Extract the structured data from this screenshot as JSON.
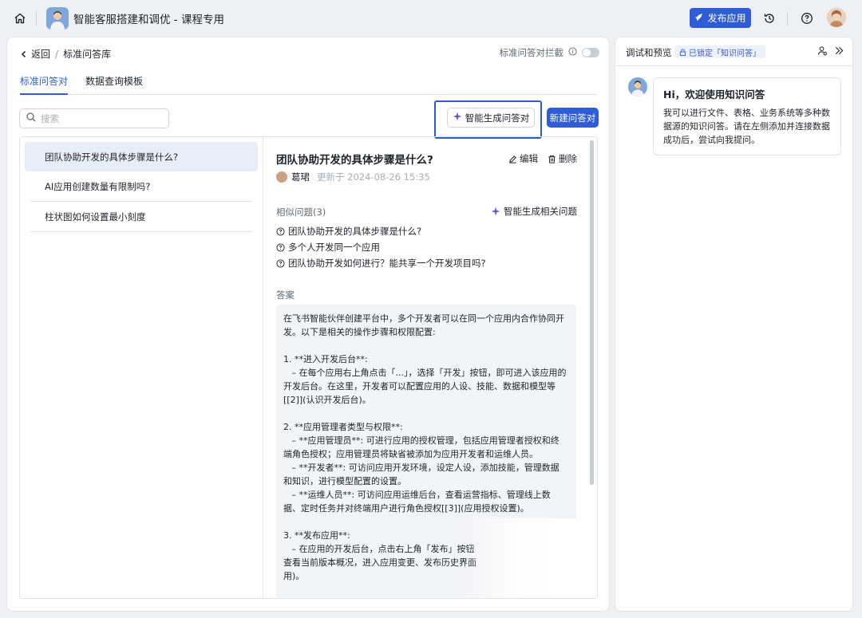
{
  "topbar": {
    "app_title": "智能客服搭建和调优 - 课程专用",
    "publish_label": "发布应用",
    "icons": [
      "home-icon",
      "rocket-icon",
      "history-icon",
      "help-icon"
    ]
  },
  "left": {
    "breadcrumb": {
      "back": "返回",
      "current": "标准问答库"
    },
    "intercept_label": "标准问答对拦截",
    "tabs": [
      {
        "label": "标准问答对",
        "active": true
      },
      {
        "label": "数据查询模板",
        "active": false
      }
    ],
    "search_placeholder": "搜索",
    "smart_gen_label": "智能生成问答对",
    "new_label": "新建问答对",
    "questions": [
      "团队协助开发的具体步骤是什么?",
      "AI应用创建数量有限制吗?",
      "柱状图如何设置最小刻度"
    ],
    "detail": {
      "title": "团队协助开发的具体步骤是什么?",
      "edit_label": "编辑",
      "delete_label": "删除",
      "author": "葛珺",
      "updated": "更新于 2024-08-26 15:35",
      "similar_label": "相似问题(3)",
      "similar_gen_label": "智能生成相关问题",
      "similar": [
        "团队协助开发的具体步骤是什么?",
        "多个人开发同一个应用",
        "团队协助开发如何进行？能共享一个开发项目吗?"
      ],
      "answer_label": "答案",
      "answer": "在飞书智能伙伴创建平台中，多个开发者可以在同一个应用内合作协同开\n发。以下是相关的操作步骤和权限配置:\n\n1. **进入开发后台**:\n   – 在每个应用右上角点击「...」，选择「开发」按钮，即可进入该应用的\n开发后台。在这里，开发者可以配置应用的人设、技能、数据和模型等\n[[2]](认识开发后台)。\n\n2. **应用管理者类型与权限**:\n   – **应用管理员**: 可进行应用的授权管理，包括应用管理者授权和终\n端角色授权；应用管理员将缺省被添加为应用开发者和运维人员。\n   – **开发者**: 可访问应用开发环境，设定人设，添加技能，管理数据\n和知识，进行模型配置的设置。\n   – **运维人员**: 可访问应用运维后台，查看运营指标、管理线上数\n据、定时任务并对终端用户进行角色授权[[3]](应用授权设置)。\n\n3. **发布应用**:\n   – 在应用的开发后台，点击右上角「发布」按钮\n查看当前版本概况，进入应用变更、发布历史界面\n用)。"
    }
  },
  "right": {
    "title": "调试和预览",
    "badge": "已锁定「知识问答」",
    "greeting_title": "Hi，欢迎使用知识问答",
    "greeting_text": "我可以进行文件、表格、业务系统等多种数据源的知识问答。请在左侧添加并连接数据成功后，尝试向我提问。"
  },
  "colors": {
    "accent": "#2f5cd8",
    "highlight_frame": "#2a5bd7",
    "selected_bg": "#e8edf8"
  }
}
